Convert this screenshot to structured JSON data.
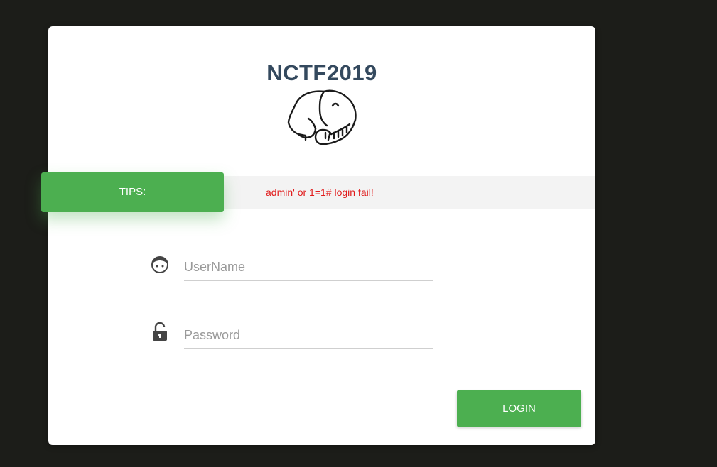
{
  "colors": {
    "page_background": "#1c1d19",
    "accent_green": "#4caf50",
    "title_color": "#34495e",
    "error_red": "#e11b1b"
  },
  "header": {
    "title": "NCTF2019",
    "logo_icon": "elephant-icon"
  },
  "tips": {
    "label": "TIPS:",
    "message": "admin' or 1=1# login fail!"
  },
  "form": {
    "username": {
      "icon": "user-face-icon",
      "placeholder": "UserName",
      "value": ""
    },
    "password": {
      "icon": "unlock-icon",
      "placeholder": "Password",
      "value": ""
    },
    "submit_label": "LOGIN"
  }
}
